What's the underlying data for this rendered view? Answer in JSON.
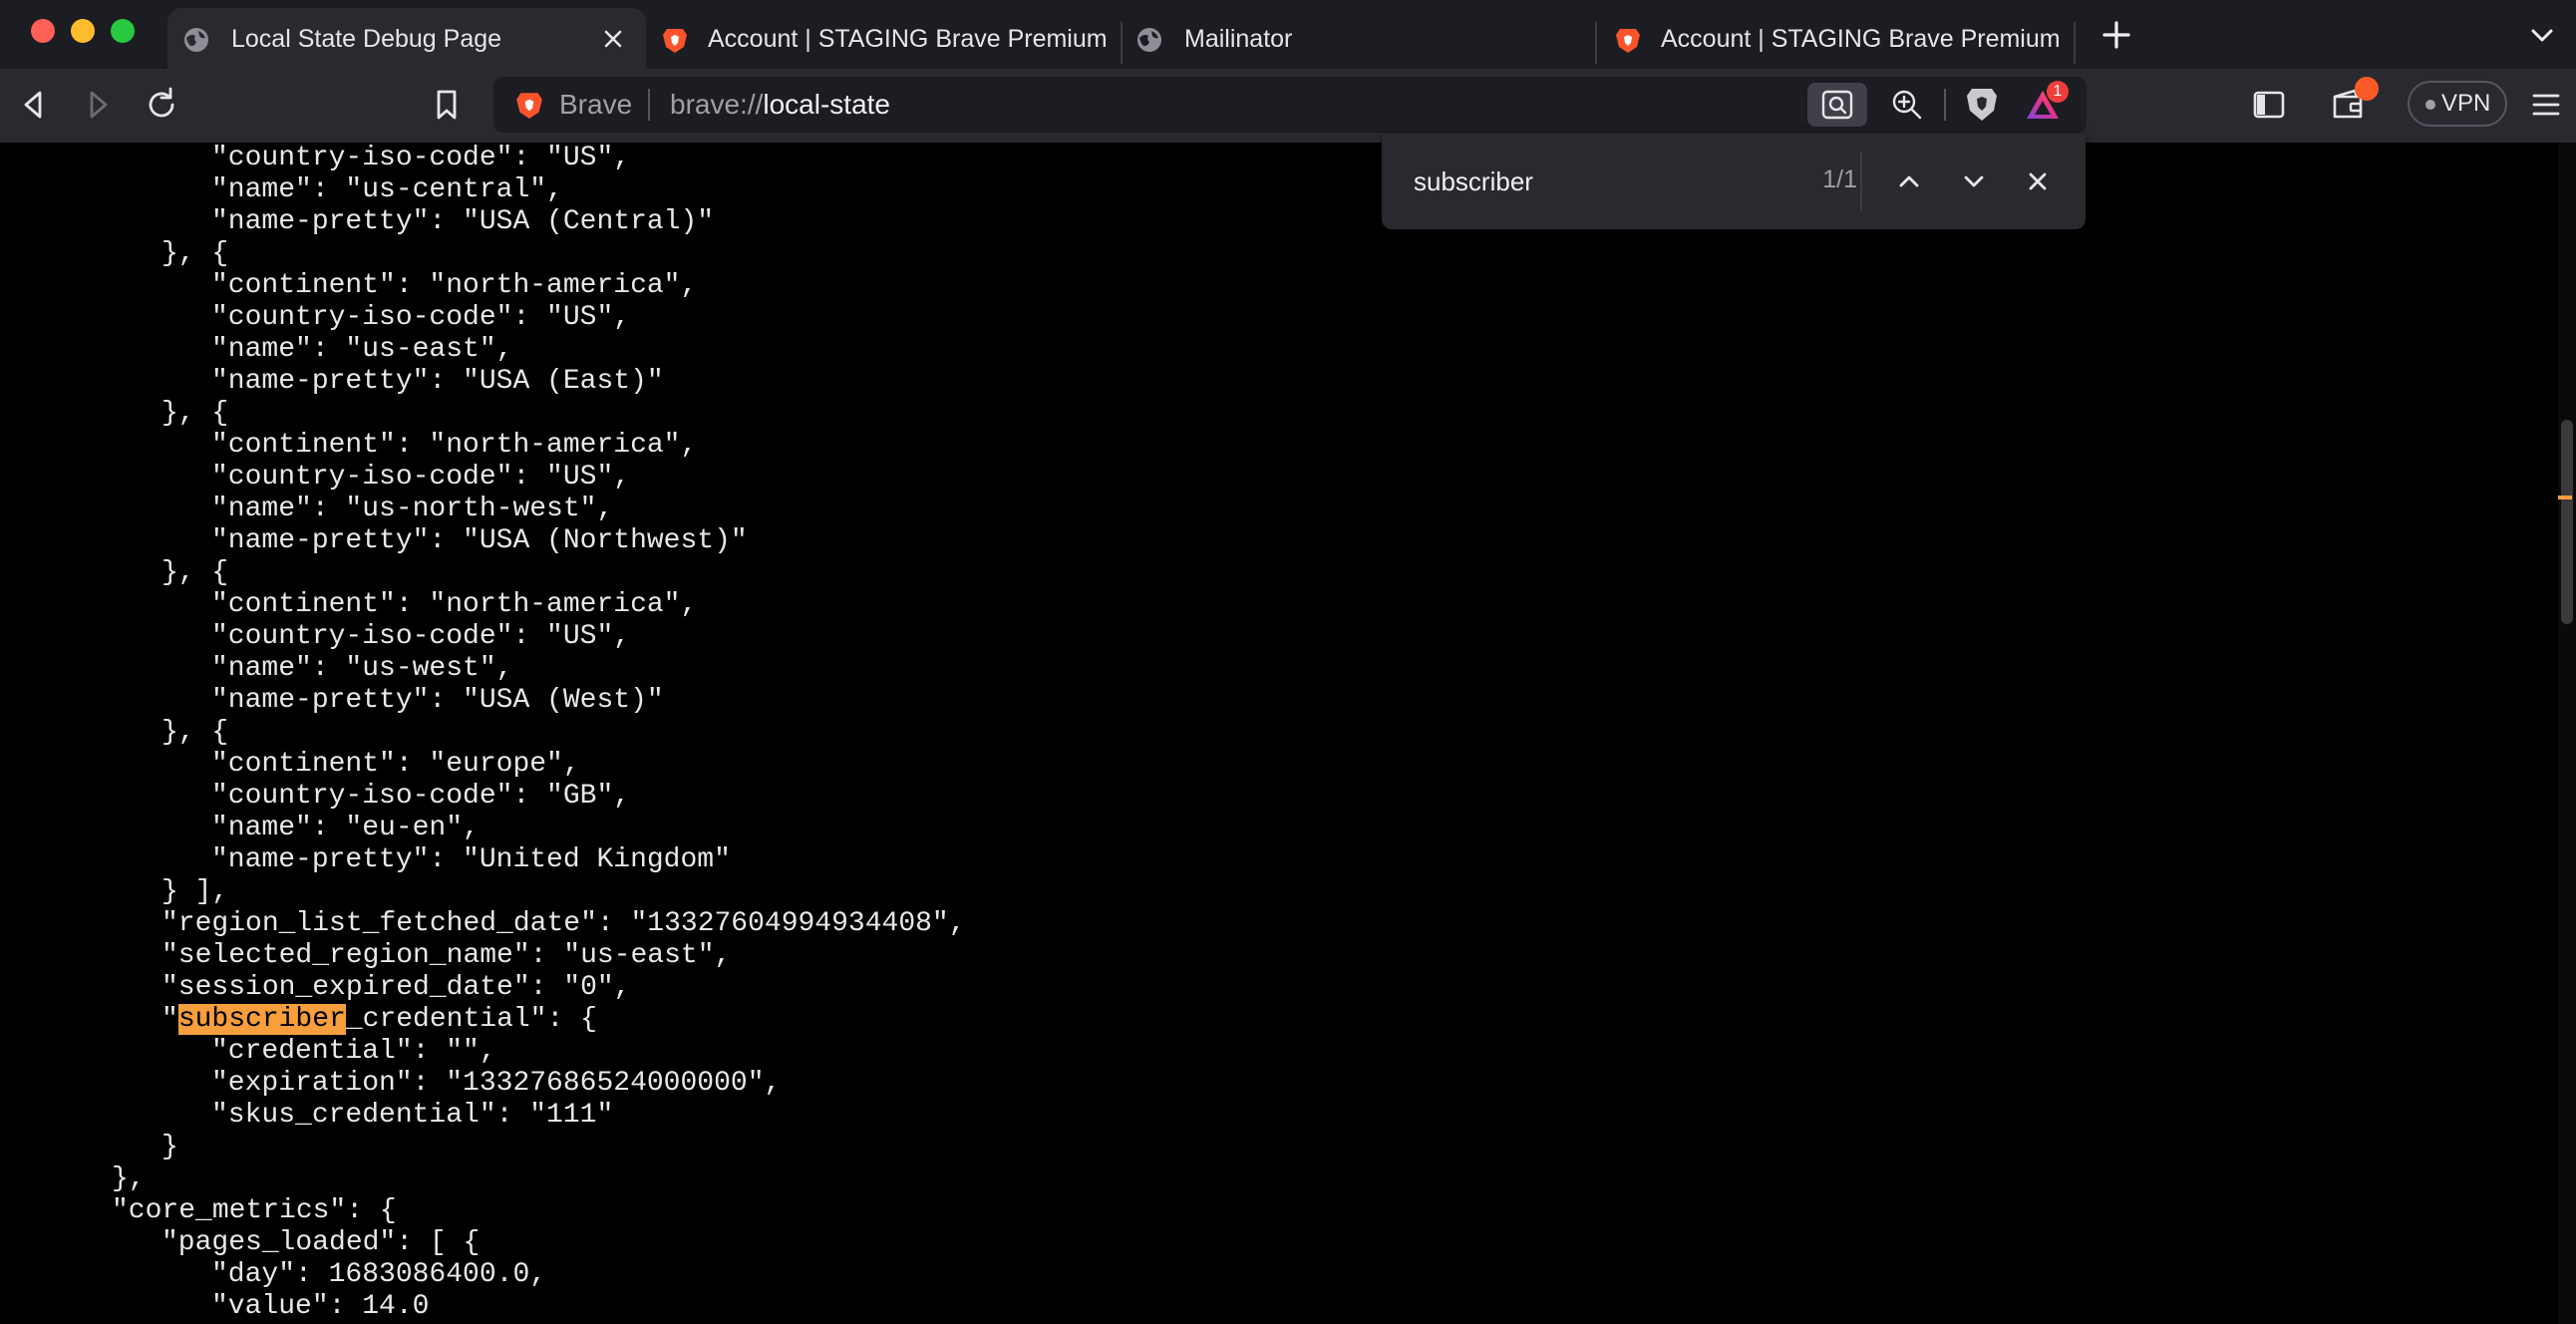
{
  "window": {
    "tabs": [
      {
        "title": "Local State Debug Page",
        "favicon": "globe-icon",
        "active": true
      },
      {
        "title": "Account | STAGING Brave Premium",
        "favicon": "brave-lion-icon",
        "active": false
      },
      {
        "title": "Mailinator",
        "favicon": "globe-icon",
        "active": false
      },
      {
        "title": "Account | STAGING Brave Premium",
        "favicon": "brave-lion-icon",
        "active": false
      }
    ]
  },
  "toolbar": {
    "site_label": "Brave",
    "url_scheme": "brave://",
    "url_host": "local-state",
    "rewards_badge": "1",
    "vpn_label": "VPN",
    "colors": {
      "wallet_badge": "#fa5a28",
      "rewards_badge": "#ef3d3d"
    }
  },
  "find": {
    "query": "subscriber",
    "count": "1/1",
    "highlight_color": "#f79e3d"
  },
  "json_lines": [
    {
      "indent": 4,
      "text": "\"country-iso-code\": \"US\","
    },
    {
      "indent": 4,
      "text": "\"name\": \"us-central\","
    },
    {
      "indent": 4,
      "text": "\"name-pretty\": \"USA (Central)\""
    },
    {
      "indent": 3,
      "text": "}, {"
    },
    {
      "indent": 4,
      "text": "\"continent\": \"north-america\","
    },
    {
      "indent": 4,
      "text": "\"country-iso-code\": \"US\","
    },
    {
      "indent": 4,
      "text": "\"name\": \"us-east\","
    },
    {
      "indent": 4,
      "text": "\"name-pretty\": \"USA (East)\""
    },
    {
      "indent": 3,
      "text": "}, {"
    },
    {
      "indent": 4,
      "text": "\"continent\": \"north-america\","
    },
    {
      "indent": 4,
      "text": "\"country-iso-code\": \"US\","
    },
    {
      "indent": 4,
      "text": "\"name\": \"us-north-west\","
    },
    {
      "indent": 4,
      "text": "\"name-pretty\": \"USA (Northwest)\""
    },
    {
      "indent": 3,
      "text": "}, {"
    },
    {
      "indent": 4,
      "text": "\"continent\": \"north-america\","
    },
    {
      "indent": 4,
      "text": "\"country-iso-code\": \"US\","
    },
    {
      "indent": 4,
      "text": "\"name\": \"us-west\","
    },
    {
      "indent": 4,
      "text": "\"name-pretty\": \"USA (West)\""
    },
    {
      "indent": 3,
      "text": "}, {"
    },
    {
      "indent": 4,
      "text": "\"continent\": \"europe\","
    },
    {
      "indent": 4,
      "text": "\"country-iso-code\": \"GB\","
    },
    {
      "indent": 4,
      "text": "\"name\": \"eu-en\","
    },
    {
      "indent": 4,
      "text": "\"name-pretty\": \"United Kingdom\""
    },
    {
      "indent": 3,
      "text": "} ],"
    },
    {
      "indent": 3,
      "text": "\"region_list_fetched_date\": \"13327604994934408\","
    },
    {
      "indent": 3,
      "text": "\"selected_region_name\": \"us-east\","
    },
    {
      "indent": 3,
      "text": "\"session_expired_date\": \"0\","
    },
    {
      "indent": 3,
      "pre": "\"",
      "match": "subscriber",
      "text": "_credential\": {"
    },
    {
      "indent": 4,
      "text": "\"credential\": \"\","
    },
    {
      "indent": 4,
      "text": "\"expiration\": \"13327686524000000\","
    },
    {
      "indent": 4,
      "text": "\"skus_credential\": \"111\""
    },
    {
      "indent": 3,
      "text": "}"
    },
    {
      "indent": 2,
      "text": "},"
    },
    {
      "indent": 2,
      "text": "\"core_metrics\": {"
    },
    {
      "indent": 3,
      "text": "\"pages_loaded\": [ {"
    },
    {
      "indent": 4,
      "text": "\"day\": 1683086400.0,"
    },
    {
      "indent": 4,
      "text": "\"value\": 14.0"
    }
  ]
}
